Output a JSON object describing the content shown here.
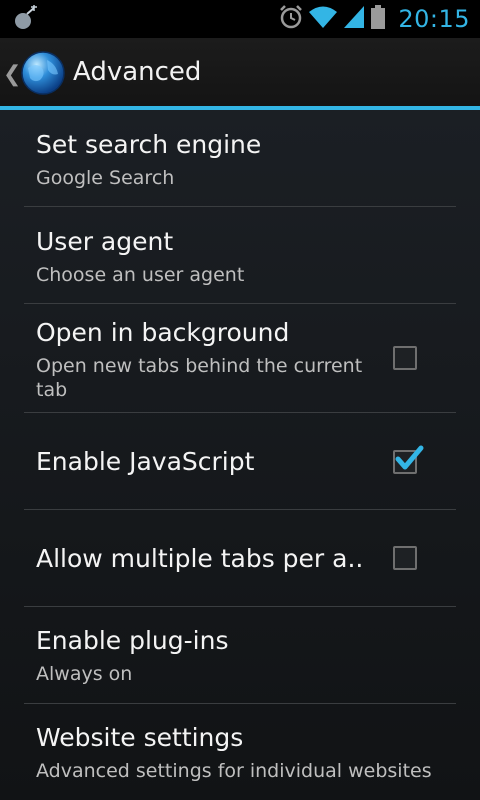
{
  "status_bar": {
    "time": "20:15",
    "icons": [
      "notification-icon",
      "alarm-icon",
      "wifi-icon",
      "signal-icon",
      "battery-icon"
    ]
  },
  "action_bar": {
    "title": "Advanced",
    "icon": "browser-globe-icon"
  },
  "accent_color": "#33b5e5",
  "preferences": [
    {
      "title": "Set search engine",
      "summary": "Google Search"
    },
    {
      "title": "User agent",
      "summary": "Choose an user agent"
    },
    {
      "title": "Open in background",
      "summary": "Open new tabs behind the current tab",
      "checked": false
    },
    {
      "title": "Enable JavaScript",
      "checked": true
    },
    {
      "title": "Allow multiple tabs per a..",
      "checked": false
    },
    {
      "title": "Enable plug-ins",
      "summary": "Always on"
    },
    {
      "title": "Website settings",
      "summary": "Advanced settings for individual websites"
    }
  ]
}
